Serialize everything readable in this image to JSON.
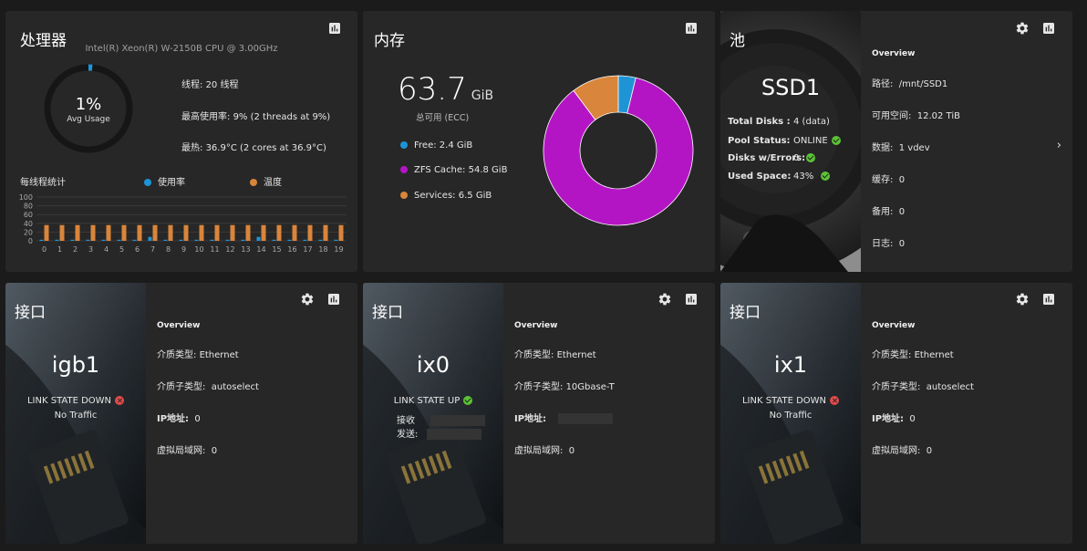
{
  "cpu": {
    "title": "处理器",
    "model": "Intel(R) Xeon(R) W-2150B CPU @ 3.00GHz",
    "usage_value": "1%",
    "usage_label": "Avg Usage",
    "usage_fraction": 0.01,
    "threads_label": "线程:",
    "threads_value": "20 线程",
    "max_usage_label": "最高使用率:",
    "max_usage_value": "9%  (2 threads at 9%)",
    "max_temp_label": "最热:",
    "max_temp_value": "36.9°C  (2 cores at 36.9°C)",
    "stats_label": "每线程统计",
    "legend_usage": "使用率",
    "legend_temp": "温度",
    "colors": {
      "usage": "#1e94d6",
      "temp": "#d9853b"
    }
  },
  "chart_data": {
    "type": "bar",
    "categories": [
      "0",
      "1",
      "2",
      "3",
      "4",
      "5",
      "6",
      "7",
      "8",
      "9",
      "10",
      "11",
      "12",
      "13",
      "14",
      "15",
      "16",
      "17",
      "18",
      "19"
    ],
    "series": [
      {
        "name": "使用率",
        "values": [
          1,
          0,
          0,
          0,
          0,
          0,
          0,
          9,
          0,
          0,
          0,
          0,
          0,
          0,
          9,
          1,
          0,
          0,
          0,
          0
        ]
      },
      {
        "name": "温度",
        "values": [
          36,
          36,
          36,
          36,
          36,
          36,
          36,
          36,
          36,
          36,
          36,
          36,
          36,
          36,
          36,
          36,
          36,
          36,
          36,
          36
        ]
      }
    ],
    "ylim": [
      0,
      100
    ],
    "yticks": [
      "100",
      "80",
      "60",
      "40",
      "20",
      "0"
    ]
  },
  "memory": {
    "title": "内存",
    "total_value": "63.7",
    "total_unit": "GiB",
    "total_label": "总可用 (ECC)",
    "items": [
      {
        "label": "Free:",
        "value": "2.4 GiB",
        "color": "#1e94d6",
        "gib": 2.4
      },
      {
        "label": "ZFS Cache:",
        "value": "54.8 GiB",
        "color": "#b415c4",
        "gib": 54.8
      },
      {
        "label": "Services:",
        "value": "6.5 GiB",
        "color": "#d9853b",
        "gib": 6.5
      }
    ]
  },
  "pool": {
    "title": "池",
    "name": "SSD1",
    "total_disks_label": "Total Disks :",
    "total_disks_value": "4 (data)",
    "status_label": "Pool Status:",
    "status_value": "ONLINE",
    "errors_label": "Disks w/Errors:",
    "errors_value": "0",
    "used_label": "Used Space:",
    "used_value": "43%",
    "overview": "Overview",
    "path_label": "路径:",
    "path_value": "/mnt/SSD1",
    "avail_label": "可用空间:",
    "avail_value": "12.02 TiB",
    "data_label": "数据:",
    "data_value": "1 vdev",
    "cache_label": "缓存:",
    "cache_value": "0",
    "spare_label": "备用:",
    "spare_value": "0",
    "log_label": "日志:",
    "log_value": "0"
  },
  "interfaces": [
    {
      "title": "接口",
      "name": "igb1",
      "link_state": "LINK STATE DOWN",
      "up": false,
      "traffic": "No Traffic",
      "overview": "Overview",
      "media_type_label": "介质类型:",
      "media_type_value": "Ethernet",
      "media_subtype_label": "介质子类型:",
      "media_subtype_value": "autoselect",
      "ip_label": "IP地址:",
      "ip_value": "0",
      "vlan_label": "虚拟局域网:",
      "vlan_value": "0"
    },
    {
      "title": "接口",
      "name": "ix0",
      "link_state": "LINK STATE UP",
      "up": true,
      "rx_label": "接收",
      "tx_label": "发送:",
      "overview": "Overview",
      "media_type_label": "介质类型:",
      "media_type_value": "Ethernet",
      "media_subtype_label": "介质子类型:",
      "media_subtype_value": "10Gbase-T",
      "ip_label": "IP地址:",
      "vlan_label": "虚拟局域网:",
      "vlan_value": "0"
    },
    {
      "title": "接口",
      "name": "ix1",
      "link_state": "LINK STATE DOWN",
      "up": false,
      "traffic": "No Traffic",
      "overview": "Overview",
      "media_type_label": "介质类型:",
      "media_type_value": "Ethernet",
      "media_subtype_label": "介质子类型:",
      "media_subtype_value": "autoselect",
      "ip_label": "IP地址:",
      "ip_value": "0",
      "vlan_label": "虚拟局域网:",
      "vlan_value": "0"
    }
  ]
}
